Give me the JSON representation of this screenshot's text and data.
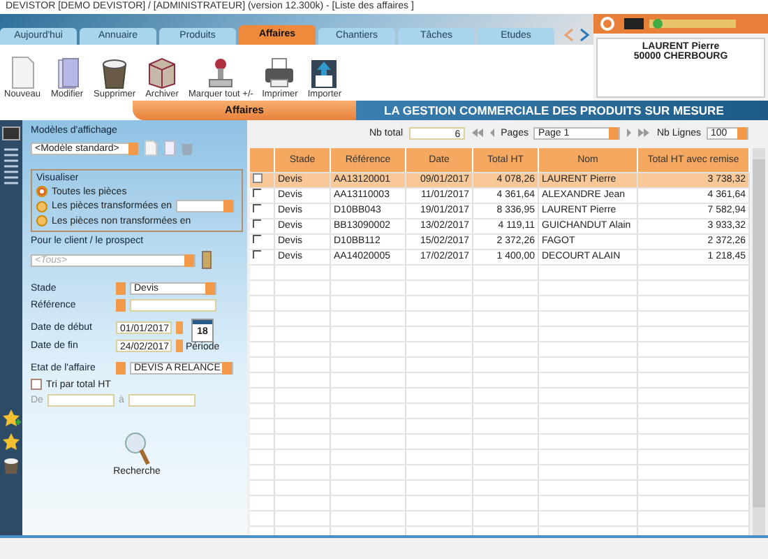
{
  "window": {
    "title": "DEVISTOR [DEMO DEVISTOR] / [ADMINISTRATEUR] (version 12.300k) - [Liste des affaires ]"
  },
  "tabs": [
    {
      "label": "Aujourd'hui",
      "selected": false
    },
    {
      "label": "Annuaire",
      "selected": false
    },
    {
      "label": "Produits",
      "selected": false
    },
    {
      "label": "Affaires",
      "selected": true
    },
    {
      "label": "Chantiers",
      "selected": false
    },
    {
      "label": "Tâches",
      "selected": false
    },
    {
      "label": "Etudes",
      "selected": false
    }
  ],
  "toolbar": [
    {
      "label": "Nouveau",
      "kind": "document"
    },
    {
      "label": "Modifier",
      "kind": "folder"
    },
    {
      "label": "Supprimer",
      "kind": "basket"
    },
    {
      "label": "Archiver",
      "kind": "box"
    },
    {
      "label": "Marquer tout +/-",
      "kind": "stamp"
    },
    {
      "label": "Imprimer",
      "kind": "printer"
    },
    {
      "label": "Importer",
      "kind": "import"
    }
  ],
  "contact": {
    "name": "LAURENT Pierre",
    "city": "50000 CHERBOURG"
  },
  "section_tab": "Affaires",
  "banner": "LA GESTION COMMERCIALE DES PRODUITS SUR MESURE",
  "filters": {
    "models_label": "Modèles d'affichage",
    "model": "<Modèle standard>",
    "visualiser_label": "Visualiser",
    "visualiser": [
      {
        "label": "Toutes les pièces",
        "selected": true,
        "with_dropdown": false
      },
      {
        "label": "Les pièces transformées en",
        "selected": false,
        "with_dropdown": true
      },
      {
        "label": "Les pièces non transformées en",
        "selected": false,
        "with_dropdown": false
      }
    ],
    "client_label": "Pour le client / le prospect",
    "client_placeholder": "<Tous>",
    "stade_label": "Stade",
    "stade": "Devis",
    "reference_label": "Référence",
    "start_label": "Date de début",
    "start": "01/01/2017",
    "end_label": "Date de fin",
    "end": "24/02/2017",
    "calendar_day": "18",
    "period_label": "Période",
    "etat_label": "Etat de l'affaire",
    "etat": "DEVIS A RELANCE",
    "sort_label": "Tri par total HT",
    "sort_checked": false,
    "from_label": "De",
    "to_label": "à",
    "search_label": "Recherche"
  },
  "pager": {
    "total_label": "Nb total",
    "total": "6",
    "pages_label": "Pages",
    "page": "Page 1",
    "lines_label": "Nb Lignes",
    "lines": "100"
  },
  "table": {
    "columns": [
      "Stade",
      "Référence",
      "Date",
      "Total HT",
      "Nom",
      "Total HT avec remise"
    ],
    "rows": [
      {
        "cells": [
          "Devis",
          "AA13120001",
          "09/01/2017",
          "4 078,26",
          "LAURENT Pierre",
          "3 738,32"
        ],
        "selected": true,
        "checked": false
      },
      {
        "cells": [
          "Devis",
          "AA13110003",
          "11/01/2017",
          "4 361,64",
          "ALEXANDRE Jean",
          "4 361,64"
        ],
        "selected": false,
        "checked": false
      },
      {
        "cells": [
          "Devis",
          "D10BB043",
          "19/01/2017",
          "8 336,95",
          "LAURENT Pierre",
          "7 582,94"
        ],
        "selected": false,
        "checked": false
      },
      {
        "cells": [
          "Devis",
          "BB13090002",
          "13/02/2017",
          "4 119,11",
          "GUICHANDUT Alain",
          "3 933,32"
        ],
        "selected": false,
        "checked": false
      },
      {
        "cells": [
          "Devis",
          "D10BB112",
          "15/02/2017",
          "2 372,26",
          "FAGOT",
          "2 372,26"
        ],
        "selected": false,
        "checked": false
      },
      {
        "cells": [
          "Devis",
          "AA14020005",
          "17/02/2017",
          "1 400,00",
          "DECOURT ALAIN",
          "1 218,45"
        ],
        "selected": false,
        "checked": false
      }
    ]
  }
}
